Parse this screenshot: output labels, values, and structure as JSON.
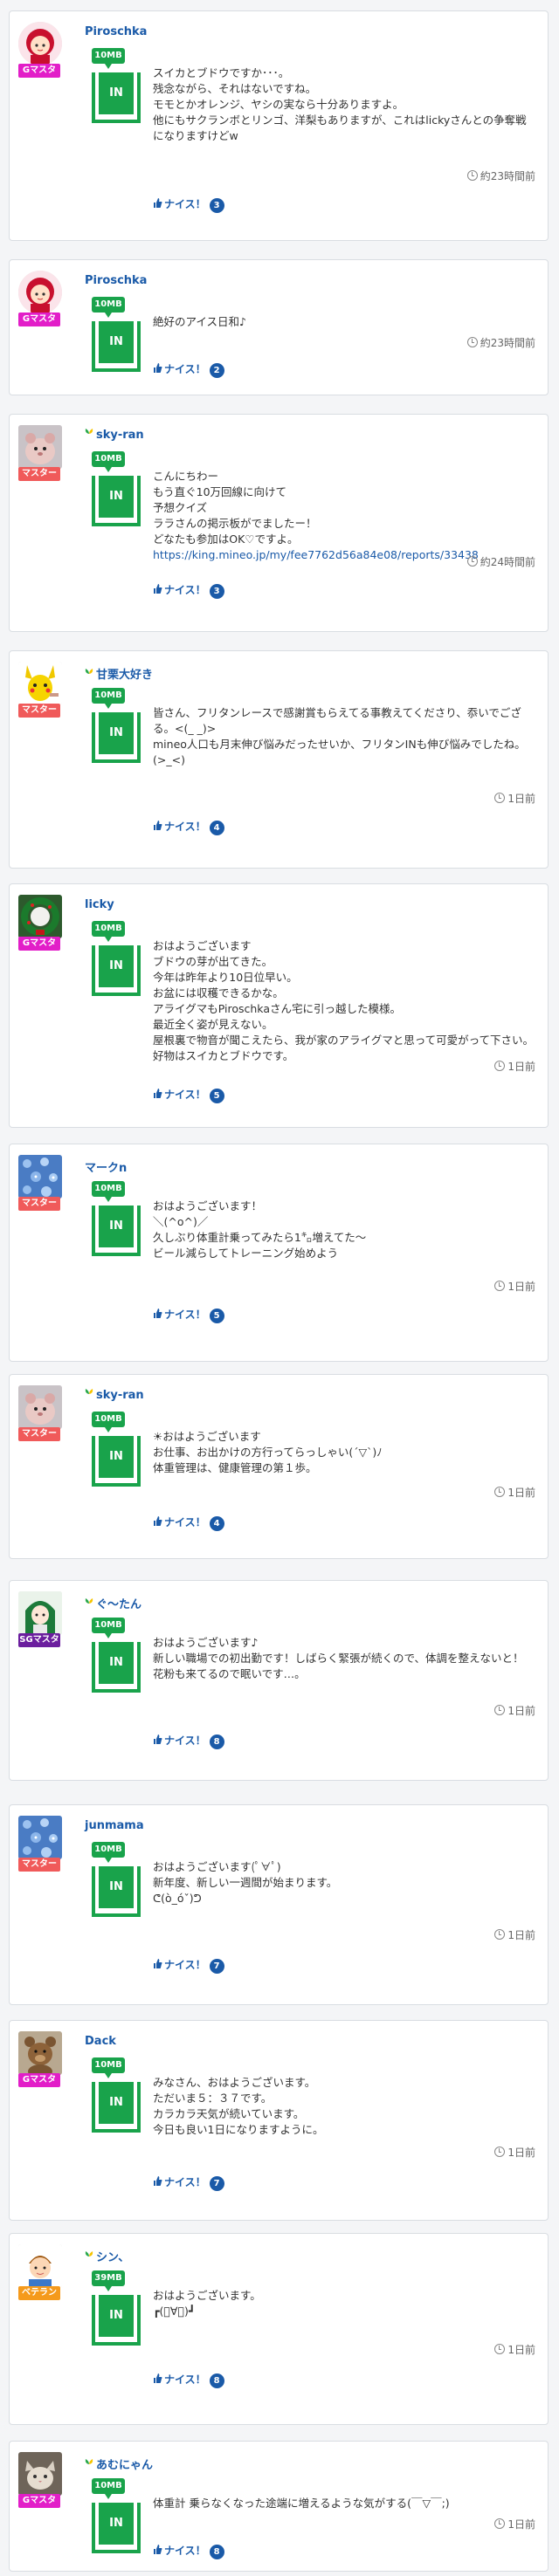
{
  "nice_label": "ナイス！",
  "posts": [
    {
      "user": "Piroschka",
      "beginner": false,
      "badge": "Gマスター",
      "badge_color": "#e21ec8",
      "data": "10MB",
      "in_label": "IN",
      "lines": [
        "スイカとブドウですか･･･。",
        "残念ながら、それはないですね。",
        "モモとかオレンジ、ヤシの実なら十分ありますよ。",
        "他にもサクランボとリンゴ、洋梨もありますが、これはlickyさんとの争奪戦になりますけどw"
      ],
      "time": "約23時間前",
      "nice_count": "3",
      "avatar": "girl-red"
    },
    {
      "user": "Piroschka",
      "beginner": false,
      "badge": "Gマスター",
      "badge_color": "#e21ec8",
      "data": "10MB",
      "in_label": "IN",
      "lines": [
        "絶好のアイス日和♪"
      ],
      "time": "約23時間前",
      "nice_count": "2",
      "avatar": "girl-red"
    },
    {
      "user": "sky-ran",
      "beginner": true,
      "badge": "マスター",
      "badge_color": "#f05a5a",
      "data": "10MB",
      "in_label": "IN",
      "lines": [
        "こんにちわー",
        "もう直ぐ10万回線に向けて",
        "予想クイズ",
        "ララさんの掲示板がでましたー！",
        "どなたも参加はOK♡ですよ。"
      ],
      "link": "https://king.mineo.jp/my/fee7762d56a84e08/reports/33438",
      "time": "約24時間前",
      "nice_count": "3",
      "avatar": "hamster"
    },
    {
      "user": "甘栗大好き",
      "beginner": true,
      "badge": "マスター",
      "badge_color": "#f05a5a",
      "data": "10MB",
      "in_label": "IN",
      "lines": [
        "皆さん、フリタンレースで感謝賞もらえてる事教えてくださり、忝いでござる。<(_ _)>",
        "mineo人口も月末伸び悩みだったせいか、フリタンINも伸び悩みでしたね。(>_<)"
      ],
      "time": "1日前",
      "nice_count": "4",
      "avatar": "pikachu"
    },
    {
      "user": "licky",
      "beginner": false,
      "badge": "Gマスター",
      "badge_color": "#e21ec8",
      "data": "10MB",
      "in_label": "IN",
      "lines": [
        "おはようございます",
        "ブドウの芽が出てきた。",
        "今年は昨年より10日位早い。",
        "お盆には収穫できるかな。",
        "アライグマもPiroschkaさん宅に引っ越した模様。",
        "最近全く姿が見えない。",
        "屋根裏で物音が聞こえたら、我が家のアライグマと思って可愛がって下さい。",
        "好物はスイカとブドウです。"
      ],
      "time": "1日前",
      "nice_count": "5",
      "avatar": "wreath"
    },
    {
      "user": "マークn",
      "beginner": false,
      "badge": "マスター",
      "badge_color": "#f05a5a",
      "data": "10MB",
      "in_label": "IN",
      "lines": [
        "おはようございます！",
        "＼(^o^)／",
        "久しぶり体重計乗ってみたら1㌔増えてた〜",
        "ビール減らしてトレーニング始めよう"
      ],
      "time": "1日前",
      "nice_count": "5",
      "avatar": "flowers-blue"
    },
    {
      "user": "sky-ran",
      "beginner": true,
      "badge": "マスター",
      "badge_color": "#f05a5a",
      "data": "10MB",
      "in_label": "IN",
      "lines": [
        "☀おはようございます",
        "お仕事、お出かけの方行ってらっしゃい(´▽`)ﾉ",
        "体重管理は、健康管理の第１歩。"
      ],
      "time": "1日前",
      "nice_count": "4",
      "avatar": "hamster"
    },
    {
      "user": "ぐ〜たん",
      "beginner": true,
      "badge": "SGマスタ",
      "badge_color": "#6b1e9e",
      "data": "10MB",
      "in_label": "IN",
      "lines": [
        "おはようございます♪",
        "新しい職場での初出勤です！しばらく緊張が続くので、体調を整えないと！",
        "花粉も来てるので眠いです…。"
      ],
      "time": "1日前",
      "nice_count": "8",
      "avatar": "anime-green"
    },
    {
      "user": "junmama",
      "beginner": false,
      "badge": "マスター",
      "badge_color": "#f05a5a",
      "data": "10MB",
      "in_label": "IN",
      "lines": [
        "おはようございます(ﾟ∀ﾟ)",
        "新年度、新しい一週間が始まります。",
        "ᕦ(ò_óˇ)ᕤ"
      ],
      "time": "1日前",
      "nice_count": "7",
      "avatar": "flowers-blue"
    },
    {
      "user": "Dack",
      "beginner": false,
      "badge": "Gマスター",
      "badge_color": "#e21ec8",
      "data": "10MB",
      "in_label": "IN",
      "lines": [
        "みなさん、おはようございます。",
        "ただいま５：３７です。",
        "カラカラ天気が続いています。",
        "今日も良い1日になりますように。"
      ],
      "time": "1日前",
      "nice_count": "7",
      "avatar": "bear"
    },
    {
      "user": "シン、",
      "beginner": true,
      "badge": "ベテラン",
      "badge_color": "#f59a1c",
      "data": "39MB",
      "in_label": "IN",
      "lines": [
        "おはようございます。",
        "┏(ﾟ∀ﾟ)┛"
      ],
      "time": "1日前",
      "nice_count": "8",
      "avatar": "boy"
    },
    {
      "user": "あむにゃん",
      "beginner": true,
      "badge": "Gマスター",
      "badge_color": "#e21ec8",
      "data": "10MB",
      "in_label": "IN",
      "lines": [
        "体重計 乗らなくなった途端に増えるような気がする(￣▽￣;)"
      ],
      "time": "1日前",
      "nice_count": "8",
      "avatar": "cat"
    }
  ]
}
